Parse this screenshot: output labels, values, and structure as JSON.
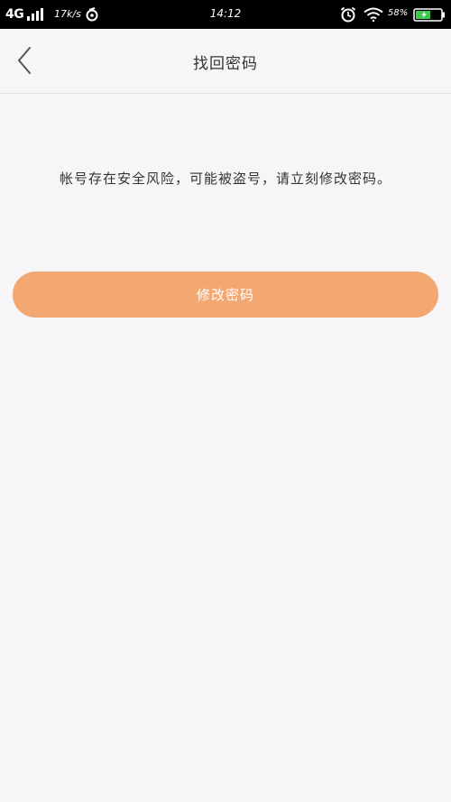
{
  "status_bar": {
    "network_type": "4G",
    "speed": "17k/s",
    "time": "14:12",
    "battery_percent": "58%",
    "icons": [
      "signal-icon",
      "netease-icon",
      "alarm-icon",
      "wifi-icon",
      "battery-icon"
    ],
    "background_color": "#000000"
  },
  "nav": {
    "title": "找回密码",
    "back_icon": "chevron-left-icon"
  },
  "main": {
    "message": "帐号存在安全风险，可能被盗号，请立刻修改密码。",
    "primary_button_label": "修改密码"
  },
  "colors": {
    "accent": "#f3a872",
    "page_background": "#f7f5f8",
    "text": "#333333"
  }
}
